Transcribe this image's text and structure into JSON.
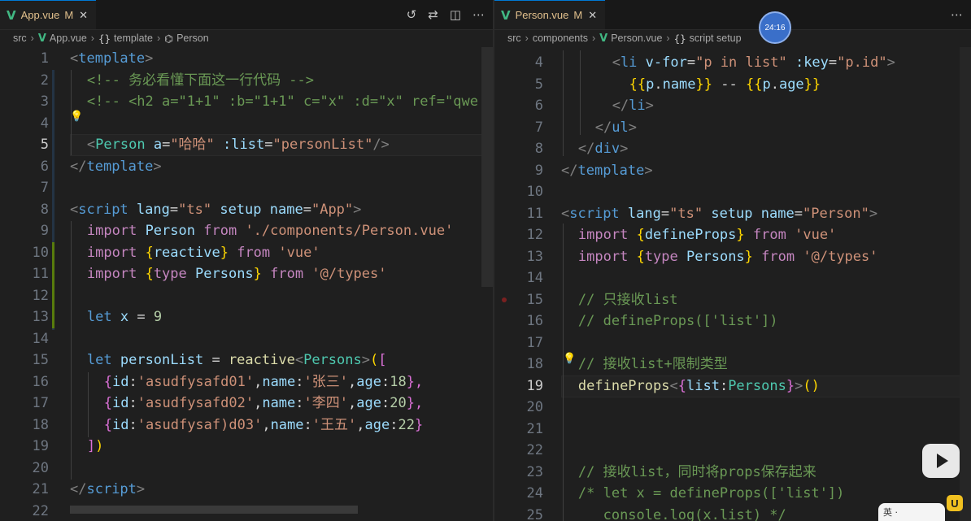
{
  "left": {
    "tab": {
      "name": "App.vue",
      "status": "M",
      "close": "✕"
    },
    "breadcrumb": {
      "src": "src",
      "file": "App.vue",
      "section": "template",
      "component": "Person"
    },
    "lines": [
      {
        "n": "1"
      },
      {
        "n": "2"
      },
      {
        "n": "3"
      },
      {
        "n": "4"
      },
      {
        "n": "5"
      },
      {
        "n": "6"
      },
      {
        "n": "7"
      },
      {
        "n": "8"
      },
      {
        "n": "9"
      },
      {
        "n": "10"
      },
      {
        "n": "11"
      },
      {
        "n": "12"
      },
      {
        "n": "13"
      },
      {
        "n": "14"
      },
      {
        "n": "15"
      },
      {
        "n": "16"
      },
      {
        "n": "17"
      },
      {
        "n": "18"
      },
      {
        "n": "19"
      },
      {
        "n": "20"
      },
      {
        "n": "21"
      },
      {
        "n": "22"
      }
    ],
    "code": {
      "l2_comment": "<!-- 务必看懂下面这一行代码 -->",
      "l3_comment": "<!-- <h2 a=\"1+1\" :b=\"1+1\" c=\"x\" :d=\"x\" ref=\"qwe",
      "l5_person": "Person",
      "l5_a": "a",
      "l5_aval": "\"哈哈\"",
      "l5_list": ":list",
      "l5_listval": "\"personList\"",
      "l8_lang": "lang",
      "l8_langval": "\"ts\"",
      "l8_setup": "setup",
      "l8_name": "name",
      "l8_nameval": "\"App\"",
      "l9": {
        "import": "import",
        "id": "Person",
        "from": "from",
        "path": "'./components/Person.vue'"
      },
      "l10": {
        "import": "import",
        "id": "reactive",
        "from": "from",
        "path": "'vue'"
      },
      "l11": {
        "import": "import",
        "type": "type",
        "id": "Persons",
        "from": "from",
        "path": "'@/types'"
      },
      "l13": {
        "let": "let",
        "id": "x",
        "num": "9"
      },
      "l15": {
        "let": "let",
        "id": "personList",
        "fn": "reactive",
        "type": "Persons"
      },
      "rows": [
        {
          "id": "'asudfysafd01'",
          "name": "'张三'",
          "age": "18",
          "tail": "},"
        },
        {
          "id": "'asudfysafd02'",
          "name": "'李四'",
          "age": "20",
          "tail": "},"
        },
        {
          "id": "'asudfysaf)d03'",
          "name": "'王五'",
          "age": "22",
          "tail": "}"
        }
      ]
    }
  },
  "right": {
    "tab": {
      "name": "Person.vue",
      "status": "M",
      "close": "✕"
    },
    "breadcrumb": {
      "src": "src",
      "folder": "components",
      "file": "Person.vue",
      "section": "script setup"
    },
    "lines": [
      {
        "n": "4"
      },
      {
        "n": "5"
      },
      {
        "n": "6"
      },
      {
        "n": "7"
      },
      {
        "n": "8"
      },
      {
        "n": "9"
      },
      {
        "n": "10"
      },
      {
        "n": "11"
      },
      {
        "n": "12"
      },
      {
        "n": "13"
      },
      {
        "n": "14"
      },
      {
        "n": "15"
      },
      {
        "n": "16"
      },
      {
        "n": "17"
      },
      {
        "n": "18"
      },
      {
        "n": "19"
      },
      {
        "n": "20"
      },
      {
        "n": "21"
      },
      {
        "n": "22"
      },
      {
        "n": "23"
      },
      {
        "n": "24"
      },
      {
        "n": "25"
      }
    ],
    "code": {
      "l4": {
        "vfor": "v-for",
        "vforval": "\"p in list\"",
        "key": ":key",
        "keyval": "\"p.id\""
      },
      "l5": {
        "p1": "p",
        "name": "name",
        "p2": "p",
        "age": "age",
        "dash": " -- "
      },
      "l11": {
        "lang": "lang",
        "langval": "\"ts\"",
        "setup": "setup",
        "name": "name",
        "nameval": "\"Person\""
      },
      "l12": {
        "import": "import",
        "id": "defineProps",
        "from": "from",
        "path": "'vue'"
      },
      "l13": {
        "import": "import",
        "type": "type",
        "id": "Persons",
        "from": "from",
        "path": "'@/types'"
      },
      "l15": "// 只接收list",
      "l16": "// defineProps(['list'])",
      "l18": "// 接收list+限制类型",
      "l19": {
        "fn": "defineProps",
        "id": "list",
        "type": "Persons"
      },
      "l23": "// 接收list，同时将props保存起来",
      "l24": "/* let x = defineProps(['list'])",
      "l25": "   console.log(x.list) */"
    }
  },
  "overlay": {
    "timer": "24:16",
    "ime_label": "英 ·"
  },
  "colors": {
    "accent": "#0078d4",
    "vue": "#41b883",
    "modified": "#e2c08d"
  }
}
